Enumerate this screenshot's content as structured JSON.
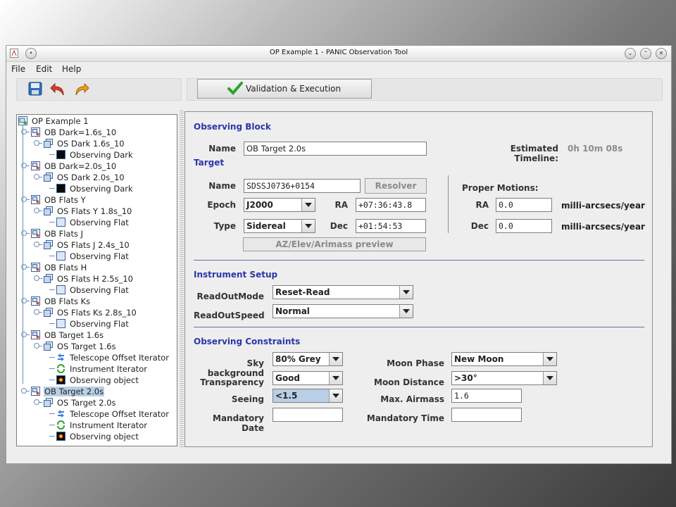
{
  "window": {
    "title": "OP Example 1 - PANIC Observation Tool"
  },
  "menu": {
    "file": "File",
    "edit": "Edit",
    "help": "Help"
  },
  "toolbar": {
    "validate_label": "Validation & Execution"
  },
  "tree": {
    "root": "OP Example 1",
    "items": [
      {
        "label": "OB Dark=1.6s_10",
        "level": 1,
        "icon": "ob"
      },
      {
        "label": "OS Dark 1.6s_10",
        "level": 2,
        "icon": "os"
      },
      {
        "label": "Observing Dark",
        "level": 3,
        "icon": "dark"
      },
      {
        "label": "OB Dark=2.0s_10",
        "level": 1,
        "icon": "ob"
      },
      {
        "label": "OS Dark 2.0s_10",
        "level": 2,
        "icon": "os"
      },
      {
        "label": "Observing Dark",
        "level": 3,
        "icon": "dark"
      },
      {
        "label": "OB Flats Y",
        "level": 1,
        "icon": "ob"
      },
      {
        "label": "OS Flats Y 1.8s_10",
        "level": 2,
        "icon": "os"
      },
      {
        "label": "Observing Flat",
        "level": 3,
        "icon": "flat"
      },
      {
        "label": "OB Flats J",
        "level": 1,
        "icon": "ob"
      },
      {
        "label": "OS Flats J 2.4s_10",
        "level": 2,
        "icon": "os"
      },
      {
        "label": "Observing Flat",
        "level": 3,
        "icon": "flat"
      },
      {
        "label": "OB Flats H",
        "level": 1,
        "icon": "ob"
      },
      {
        "label": "OS Flats H 2.5s_10",
        "level": 2,
        "icon": "os"
      },
      {
        "label": "Observing Flat",
        "level": 3,
        "icon": "flat"
      },
      {
        "label": "OB Flats Ks",
        "level": 1,
        "icon": "ob"
      },
      {
        "label": "OS Flats Ks 2.8s_10",
        "level": 2,
        "icon": "os"
      },
      {
        "label": "Observing Flat",
        "level": 3,
        "icon": "flat"
      },
      {
        "label": "OB Target 1.6s",
        "level": 1,
        "icon": "ob"
      },
      {
        "label": "OS Target 1.6s",
        "level": 2,
        "icon": "os"
      },
      {
        "label": "Telescope Offset Iterator",
        "level": 3,
        "icon": "offset"
      },
      {
        "label": "Instrument Iterator",
        "level": 3,
        "icon": "instr"
      },
      {
        "label": "Observing object",
        "level": 3,
        "icon": "object"
      },
      {
        "label": "OB Target 2.0s",
        "level": 1,
        "icon": "ob",
        "selected": true
      },
      {
        "label": "OS Target 2.0s",
        "level": 2,
        "icon": "os"
      },
      {
        "label": "Telescope Offset Iterator",
        "level": 3,
        "icon": "offset"
      },
      {
        "label": "Instrument Iterator",
        "level": 3,
        "icon": "instr"
      },
      {
        "label": "Observing object",
        "level": 3,
        "icon": "object"
      }
    ]
  },
  "ob": {
    "section": "Observing Block",
    "name_label": "Name",
    "name_value": "OB Target 2.0s",
    "timeline_label": "Estimated Timeline:",
    "timeline_value": "0h 10m 08s"
  },
  "target": {
    "section": "Target",
    "name_label": "Name",
    "name_value": "SDSSJ0736+0154",
    "resolver": "Resolver",
    "epoch_label": "Epoch",
    "epoch_value": "J2000",
    "ra_label": "RA",
    "ra_value": "+07:36:43.8",
    "type_label": "Type",
    "type_value": "Sidereal",
    "dec_label": "Dec",
    "dec_value": "+01:54:53",
    "pm_title": "Proper Motions:",
    "pm_ra_label": "RA",
    "pm_ra_value": "0.0",
    "pm_dec_label": "Dec",
    "pm_dec_value": "0.0",
    "pm_units": "milli-arcsecs/year",
    "preview": "AZ/Elev/Arimass preview"
  },
  "instrument": {
    "section": "Instrument Setup",
    "readoutmode_label": "ReadOutMode",
    "readoutmode_value": "Reset-Read",
    "readoutspeed_label": "ReadOutSpeed",
    "readoutspeed_value": "Normal"
  },
  "constraints": {
    "section": "Observing Constraints",
    "sky_label": "Sky background",
    "sky_value": "80% Grey",
    "transparency_label": "Transparency",
    "transparency_value": "Good",
    "seeing_label": "Seeing",
    "seeing_value": "<1.5",
    "mandatory_date_label": "Mandatory Date",
    "mandatory_date_value": "",
    "moon_phase_label": "Moon Phase",
    "moon_phase_value": "New Moon",
    "moon_distance_label": "Moon Distance",
    "moon_distance_value": ">30°",
    "airmass_label": "Max. Airmass",
    "airmass_value": "1.6",
    "mandatory_time_label": "Mandatory Time",
    "mandatory_time_value": ""
  },
  "colors": {
    "section": "#2c36a8",
    "selection": "#b8cfe5",
    "accent_check": "#2aa52a"
  }
}
